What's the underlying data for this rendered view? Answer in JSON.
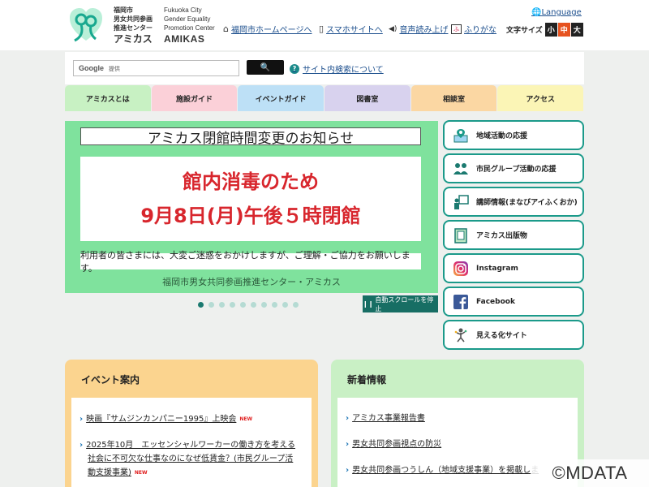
{
  "header": {
    "logo_jp_lines": [
      "福岡市",
      "男女共同参画",
      "推進センター"
    ],
    "logo_jp_name": "アミカス",
    "logo_en_lines": [
      "Fukuoka City",
      "Gender Equality",
      "Promotion Center"
    ],
    "logo_en_name": "AMIKAS",
    "nav": {
      "home": "福岡市ホームページへ",
      "mobile": "スマホサイトへ",
      "speech": "音声読み上げ",
      "furigana": "ふりがな"
    },
    "language": "Language",
    "font_size": {
      "label": "文字サイズ",
      "small": "小",
      "medium": "中",
      "large": "大"
    }
  },
  "search": {
    "brand": "Google",
    "provided": "提供",
    "button_label": "🔍",
    "help_link": "サイト内検索について"
  },
  "global_nav": [
    {
      "label": "アミカスとは",
      "color": "#c8f1c3"
    },
    {
      "label": "施設ガイド",
      "color": "#fbd0d8"
    },
    {
      "label": "イベントガイド",
      "color": "#bde0f6"
    },
    {
      "label": "図書室",
      "color": "#d8d2ee"
    },
    {
      "label": "相談室",
      "color": "#fbd7a3"
    },
    {
      "label": "アクセス",
      "color": "#fbf5b6"
    }
  ],
  "slider": {
    "headline": "アミカス閉館時間変更のお知らせ",
    "main_line1": "館内消毒のため",
    "main_line2": "9月8日(月)午後５時閉館",
    "apology": "利用者の皆さまには、大変ご迷惑をおかけしますが、ご理解・ご協力をお願いします。",
    "footer": "福岡市男女共同参画推進センター・アミカス",
    "dot_count": 10,
    "active_dot": 0,
    "pause_label": "自動スクロールを停止"
  },
  "side_links": [
    {
      "label": "地域活動の応援",
      "icon": "map-pin-icon"
    },
    {
      "label": "市民グループ活動の応援",
      "icon": "group-icon"
    },
    {
      "label": "講師情報(まなびアイふくおか)",
      "icon": "lecturer-icon"
    },
    {
      "label": "アミカス出版物",
      "icon": "book-icon"
    },
    {
      "label": "Instagram",
      "icon": "instagram-icon"
    },
    {
      "label": "Facebook",
      "icon": "facebook-icon"
    },
    {
      "label": "見える化サイト",
      "icon": "figure-icon"
    }
  ],
  "events": {
    "title": "イベント案内",
    "items": [
      {
        "lines": [
          "映画『サムジンカンパニー1995』上映会"
        ],
        "new": "NEW"
      },
      {
        "lines": [
          "2025年10月　エッセンシャルワーカーの働き方を考える",
          "社会に不可欠な仕事なのになぜ低賃金？(市民グループ活",
          "動支援事業)"
        ],
        "new": "NEW"
      }
    ]
  },
  "news": {
    "title": "新着情報",
    "items": [
      "アミカス事業報告書",
      "男女共同参画視点の防災",
      "男女共同参画つうしん（地域支援事業）を掲載しま"
    ]
  },
  "copyright": "©MDATA"
}
